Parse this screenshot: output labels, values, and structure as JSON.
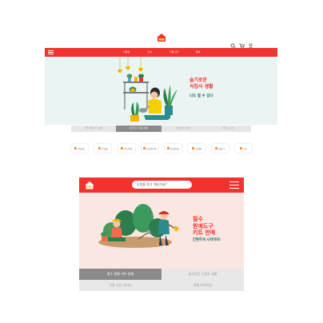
{
  "colors": {
    "brand_red": "#f2322f",
    "teal": "#1f6d72",
    "icon_orange": "#f38b2d"
  },
  "desktop": {
    "header": {
      "icons": [
        "search-icon",
        "cart-icon",
        "user-icon"
      ]
    },
    "nav": {
      "menu_icon": "menu-icon",
      "items": [
        "식물샵",
        "소식",
        "커뮤니티",
        "혜택"
      ]
    },
    "hero": {
      "title_line1": "슬기로운",
      "title_line2": "식집사 생활",
      "subtitle": "나도 할 수 있다"
    },
    "tabs": [
      {
        "label": "필수 원예 키트 판매",
        "active": false
      },
      {
        "label": "슬기로운 식집사 생활",
        "active": true
      },
      {
        "label": "식물 상담 서비스",
        "active": false
      },
      {
        "label": "특별 프로모션",
        "active": false
      }
    ],
    "categories": [
      "관엽식물",
      "공기정화",
      "다육·선인장",
      "허브/채소/과일",
      "꽃/화분식물",
      "수경재배",
      "원예도구",
      "비료"
    ]
  },
  "mobile": {
    "search": {
      "placeholder": "무엇을 찾고 계신가요?"
    },
    "hero": {
      "title_line1": "필수",
      "title_line2": "원예도구",
      "title_line3": "키트 판매",
      "subtitle": "간편하게 시작하자!"
    },
    "tabs": [
      {
        "label": "필수 원예 키트 판매",
        "active": true
      },
      {
        "label": "슬기로운 식집사 생활",
        "active": false
      },
      {
        "label": "식물 상담 서비스",
        "active": false
      },
      {
        "label": "특별 프로모션",
        "active": false
      }
    ]
  }
}
